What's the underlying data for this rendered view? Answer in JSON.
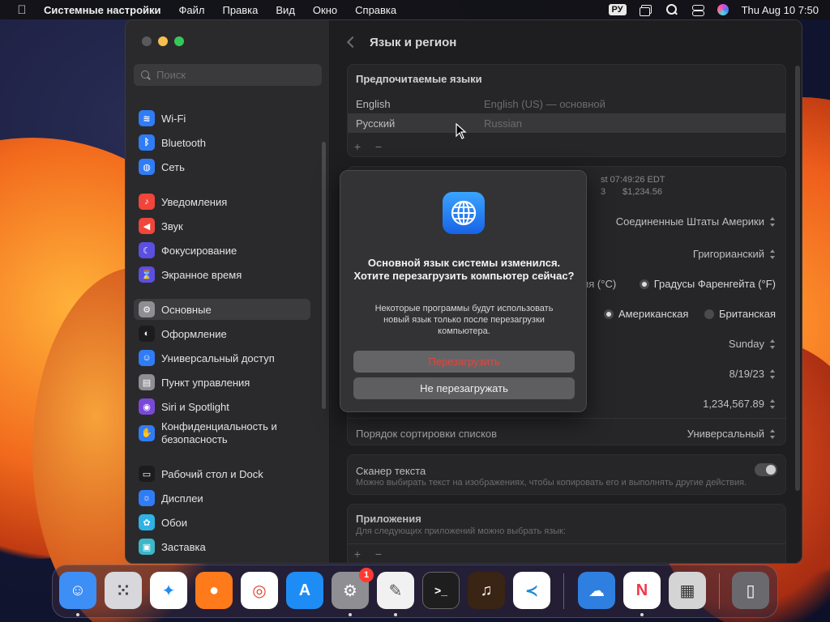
{
  "menubar": {
    "app_name": "Системные настройки",
    "items": [
      "Файл",
      "Правка",
      "Вид",
      "Окно",
      "Справка"
    ],
    "input_source": "РУ",
    "clock": "Thu Aug 10  7:50"
  },
  "sidebar": {
    "search_placeholder": "Поиск",
    "items": [
      {
        "label": "Wi-Fi",
        "icon": "wifi-icon",
        "color": "#2f7cf6"
      },
      {
        "label": "Bluetooth",
        "icon": "bluetooth-icon",
        "color": "#2f7cf6"
      },
      {
        "label": "Сеть",
        "icon": "globe-icon",
        "color": "#2f7cf6"
      },
      {
        "label": "Уведомления",
        "icon": "bell-icon",
        "color": "#f0453a"
      },
      {
        "label": "Звук",
        "icon": "speaker-icon",
        "color": "#f0453a"
      },
      {
        "label": "Фокусирование",
        "icon": "moon-icon",
        "color": "#5b4fe0"
      },
      {
        "label": "Экранное время",
        "icon": "hourglass-icon",
        "color": "#5b4fe0"
      },
      {
        "label": "Основные",
        "icon": "gear-icon",
        "color": "#8e8e93"
      },
      {
        "label": "Оформление",
        "icon": "appearance-icon",
        "color": "#1c1c1e"
      },
      {
        "label": "Универсальный доступ",
        "icon": "accessibility-icon",
        "color": "#2f7cf6"
      },
      {
        "label": "Пункт управления",
        "icon": "control-center-icon",
        "color": "#8e8e93"
      },
      {
        "label": "Siri и Spotlight",
        "icon": "siri-icon",
        "color": "#7a48d8"
      },
      {
        "label": "Конфиденциальность и безопасность",
        "icon": "hand-icon",
        "color": "#2f7cf6"
      },
      {
        "label": "Рабочий стол и Dock",
        "icon": "dock-icon",
        "color": "#1c1c1e"
      },
      {
        "label": "Дисплеи",
        "icon": "sun-icon",
        "color": "#2f7cf6"
      },
      {
        "label": "Обои",
        "icon": "flower-icon",
        "color": "#2fb2e6"
      },
      {
        "label": "Заставка",
        "icon": "screensaver-icon",
        "color": "#3bb7c9"
      },
      {
        "label": "Экономия энергии",
        "icon": "battery-icon",
        "color": "#f2a31b"
      }
    ]
  },
  "content": {
    "title": "Язык и регион",
    "preferred_languages": {
      "title": "Предпочитаемые языки",
      "rows": [
        {
          "name": "English",
          "desc": "English (US) — основной"
        },
        {
          "name": "Русский",
          "desc": "Russian"
        }
      ]
    },
    "format_preview": {
      "line1": "st 07:49:26 EDT",
      "line2a": "3",
      "line2b": "$1,234.56"
    },
    "region_value": "Соединенные Штаты Америки",
    "calendar_value": "Григорианский",
    "temp_celsius": "ия (°C)",
    "temp_fahrenheit": "Градусы Фаренгейта (°F)",
    "measure_us": "Американская",
    "measure_uk": "Британская",
    "first_day_value": "Sunday",
    "date_format_value": "8/19/23",
    "number_format_value": "1,234,567.89",
    "sort_label": "Порядок сортировки списков",
    "sort_value": "Универсальный",
    "live_text_title": "Сканер текста",
    "live_text_desc": "Можно выбирать текст на изображениях, чтобы копировать его и выполнять другие действия.",
    "apps_title": "Приложения",
    "apps_desc": "Для следующих приложений можно выбрать язык:"
  },
  "dialog": {
    "title": "Основной язык системы изменился. Хотите перезагрузить компьютер сейчас?",
    "message": "Некоторые программы будут использовать новый язык только после перезагрузки компьютера.",
    "restart_label": "Перезагрузить",
    "dont_label": "Не перезагружать"
  },
  "dock": {
    "settings_badge": "1",
    "apps": [
      {
        "name": "finder-icon",
        "color": "#3d8ef5"
      },
      {
        "name": "launchpad-icon",
        "color": "#d7d7dc"
      },
      {
        "name": "safari-icon",
        "color": "#ffffff"
      },
      {
        "name": "firefox-icon",
        "color": "#ff7a1a"
      },
      {
        "name": "chrome-icon",
        "color": "#ffffff"
      },
      {
        "name": "app-store-icon",
        "color": "#1e8cf5"
      },
      {
        "name": "system-settings-icon",
        "color": "#8e8e93"
      },
      {
        "name": "textedit-icon",
        "color": "#f1f1f1"
      },
      {
        "name": "terminal-icon",
        "color": "#1e1e1e"
      },
      {
        "name": "garageband-icon",
        "color": "#3a2414"
      },
      {
        "name": "vscode-icon",
        "color": "#ffffff"
      },
      {
        "name": "weather-icon",
        "color": "#2e7fe0"
      },
      {
        "name": "news-icon",
        "color": "#ffffff"
      },
      {
        "name": "calculator-icon",
        "color": "#d4d4d4"
      },
      {
        "name": "trash-icon",
        "color": "#6a6a6e"
      }
    ]
  }
}
